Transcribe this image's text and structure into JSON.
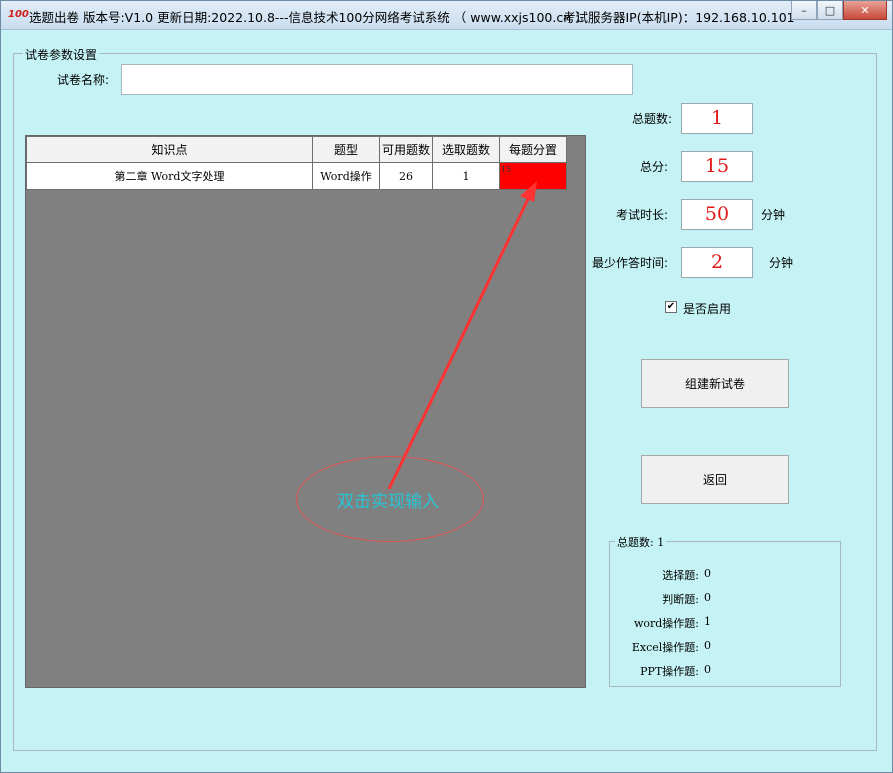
{
  "window": {
    "icon_text": "100",
    "title": "选题出卷 版本号:V1.0 更新日期:2022.10.8---信息技术100分网络考试系统  （ www.xxjs100.cn ）",
    "server_ip": "考试服务器IP(本机IP)：192.168.10.101",
    "minimize": "–",
    "maximize": "□",
    "close": "✕"
  },
  "params": {
    "legend": "试卷参数设置",
    "paper_name_label": "试卷名称:",
    "paper_name_value": ""
  },
  "grid": {
    "columns": [
      "知识点",
      "题型",
      "可用题数",
      "选取题数",
      "每题分置"
    ],
    "rows": [
      {
        "topic": "第二章 Word文字处理",
        "type": "Word操作",
        "available": "26",
        "selected": "1",
        "score": "15"
      }
    ]
  },
  "stats": {
    "total_q_label": "总题数:",
    "total_q_value": "1",
    "total_score_label": "总分:",
    "total_score_value": "15",
    "duration_label": "考试时长:",
    "duration_value": "50",
    "duration_unit": "分钟",
    "min_time_label": "最少作答时间:",
    "min_time_value": "2",
    "min_time_unit": "分钟",
    "enable_label": "是否启用",
    "enable_checked": "✔"
  },
  "buttons": {
    "build": "组建新试卷",
    "back": "返回"
  },
  "summary": {
    "legend": "总题数: 1",
    "items": [
      {
        "label": "选择题:",
        "value": "0"
      },
      {
        "label": "判断题:",
        "value": "0"
      },
      {
        "label": "word操作题:",
        "value": "1"
      },
      {
        "label": "Excel操作题:",
        "value": "0"
      },
      {
        "label": "PPT操作题:",
        "value": "0"
      }
    ]
  },
  "annotation": {
    "text": "双击实现输入",
    "color": "#27c5d6",
    "arrow_color": "#ff3333"
  }
}
